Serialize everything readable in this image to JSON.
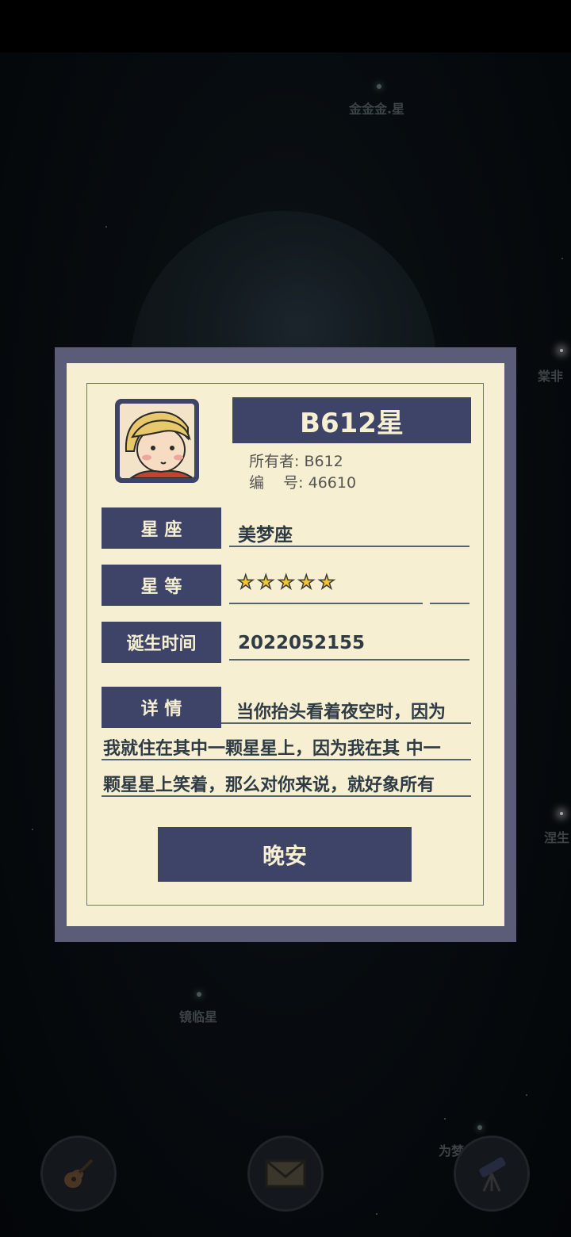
{
  "background_stars": {
    "labels": [
      "金金金.星",
      "棠非",
      "涅生",
      "镜临星",
      "为梦"
    ]
  },
  "dialog": {
    "planet_name": "B612星",
    "owner_line": "所有者: B612",
    "number_line": "编    号: 46610",
    "fields": [
      {
        "label": "星  座",
        "value": "美梦座"
      },
      {
        "label": "星  等",
        "rating": 5,
        "max_rating": 5
      },
      {
        "label": "诞生时间",
        "value": "2022052155"
      }
    ],
    "details": {
      "label": "详  情",
      "lines": [
        "当你抬头看着夜空时，因为",
        "我就住在其中一颗星星上，因为我在其 中一",
        "颗星星上笑着，那么对你来说，就好象所有"
      ]
    },
    "confirm_label": "晚安"
  },
  "bottom_bar": {
    "buttons": [
      "guitar-icon",
      "mail-icon",
      "telescope-icon"
    ]
  },
  "colors": {
    "panel": "#f7efd2",
    "frame": "#5a5c78",
    "accent": "#3e4467",
    "star_fill": "#f5c33a"
  }
}
